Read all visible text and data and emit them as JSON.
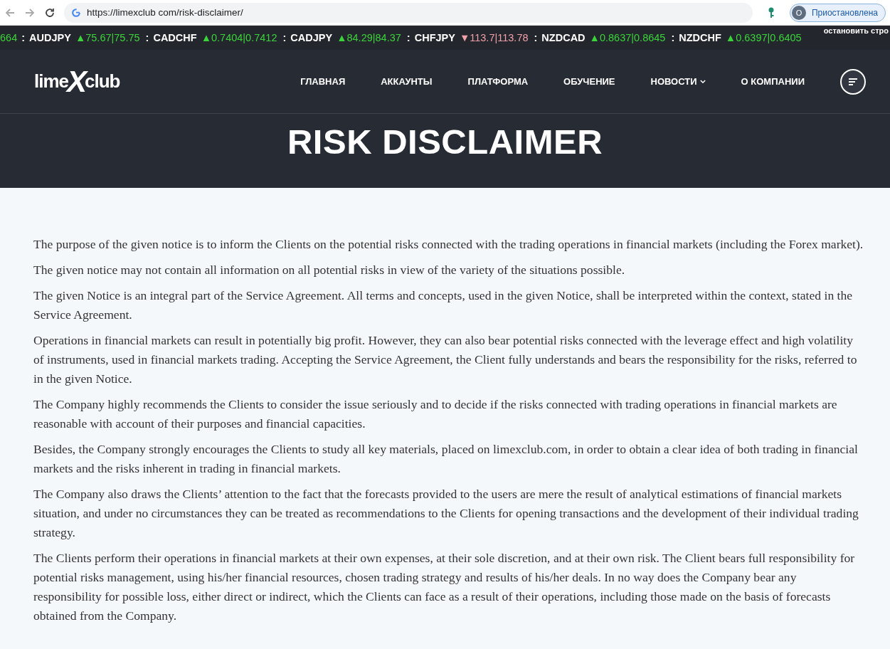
{
  "browser": {
    "url": "https://limexclub com/risk-disclaimer/",
    "profile_initial": "О",
    "profile_status": "Приостановлена"
  },
  "ticker": {
    "lead": "664",
    "separator": ":",
    "stop_label": "остановить стро",
    "items": [
      {
        "pair": "AUDJPY",
        "falling": false,
        "quote": "▲75.67|75.75"
      },
      {
        "pair": "CADCHF",
        "falling": false,
        "quote": "▲0.7404|0.7412"
      },
      {
        "pair": "CADJPY",
        "falling": false,
        "quote": "▲84.29|84.37"
      },
      {
        "pair": "CHFJPY",
        "falling": true,
        "quote": "▼113.7|113.78"
      },
      {
        "pair": "NZDCAD",
        "falling": false,
        "quote": "▲0.8637|0.8645"
      },
      {
        "pair": "NZDCHF",
        "falling": false,
        "quote": "▲0.6397|0.6405"
      }
    ]
  },
  "header": {
    "logo": {
      "left": "lime",
      "mark": "X",
      "right": "club"
    },
    "nav": [
      {
        "label": "ГЛАВНАЯ",
        "dropdown": false
      },
      {
        "label": "АККАУНТЫ",
        "dropdown": false
      },
      {
        "label": "ПЛАТФОРМА",
        "dropdown": false
      },
      {
        "label": "ОБУЧЕНИЕ",
        "dropdown": false
      },
      {
        "label": "НОВОСТИ",
        "dropdown": true
      },
      {
        "label": "О КОМПАНИИ",
        "dropdown": false
      }
    ]
  },
  "page_title": "RISK DISCLAIMER",
  "paragraphs": [
    "The purpose of the given notice is to inform the Clients on the potential risks connected with the trading operations in financial markets (including the Forex market).",
    "The given notice may not contain all information on all potential risks in view of the variety of the situations possible.",
    "The given Notice is an integral part of the Service Agreement. All terms and concepts, used in the given Notice, shall be interpreted within the context, stated in the Service Agreement.",
    "Operations in financial markets can result in potentially big profit. However, they can also bear potential risks connected with the leverage effect and high volatility of instruments, used in financial markets trading. Accepting the Service Agreement, the Client fully understands and bears the responsibility for the risks, referred to in the given Notice.",
    "The Company highly recommends the Clients to consider the issue seriously and to decide if the risks connected with trading operations in financial markets are reasonable with account of their purposes and financial capacities.",
    "Besides, the Company strongly encourages the Clients to study all key materials, placed on limexclub.com, in order to obtain a clear idea of both trading in financial markets and the risks inherent in trading in financial markets.",
    "The Company also draws the Clients’ attention to the fact that the forecasts provided to the users are mere the result of analytical estimations of financial markets situation, and under no circumstances they can be treated as recommendations to the Clients for opening transactions and the development of their individual trading strategy.",
    "The Clients perform their operations in financial markets at their own expenses, at their sole discretion, and at their own risk. The Client bears full responsibility for potential risks management, using his/her financial resources, chosen trading strategy and results of his/her deals. In no way does the Company bear any responsibility for possible loss, either direct or indirect, which the Clients can face as a result of their operations, including those made on the basis of forecasts obtained from the Company."
  ]
}
